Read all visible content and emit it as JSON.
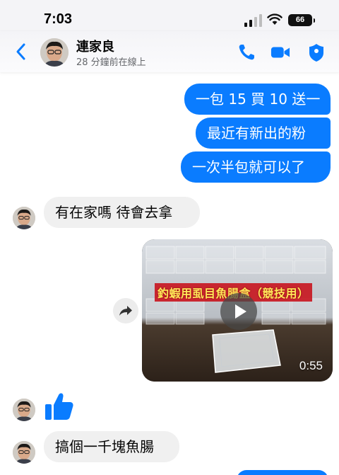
{
  "status_bar": {
    "time": "7:03",
    "battery": "66"
  },
  "header": {
    "name": "連家良",
    "status": "28 分鐘前在線上"
  },
  "messages": {
    "out_1": "一包 15 買 10 送一",
    "out_2": "最近有新出的粉",
    "out_3": "一次半包就可以了",
    "in_1": "有在家嗎 待會去拿",
    "video": {
      "title": "釣蝦用虱目魚腸盒（競技用）",
      "duration": "0:55"
    },
    "in_2": "搞個一千塊魚腸"
  },
  "colors": {
    "accent": "#0a7cff",
    "incoming_bubble": "#f0f0f0",
    "like": "#0a7cff"
  },
  "icons": [
    "back-icon",
    "phone-icon",
    "video-call-icon",
    "shield-icon",
    "share-icon",
    "play-icon",
    "thumbs-up-icon"
  ]
}
